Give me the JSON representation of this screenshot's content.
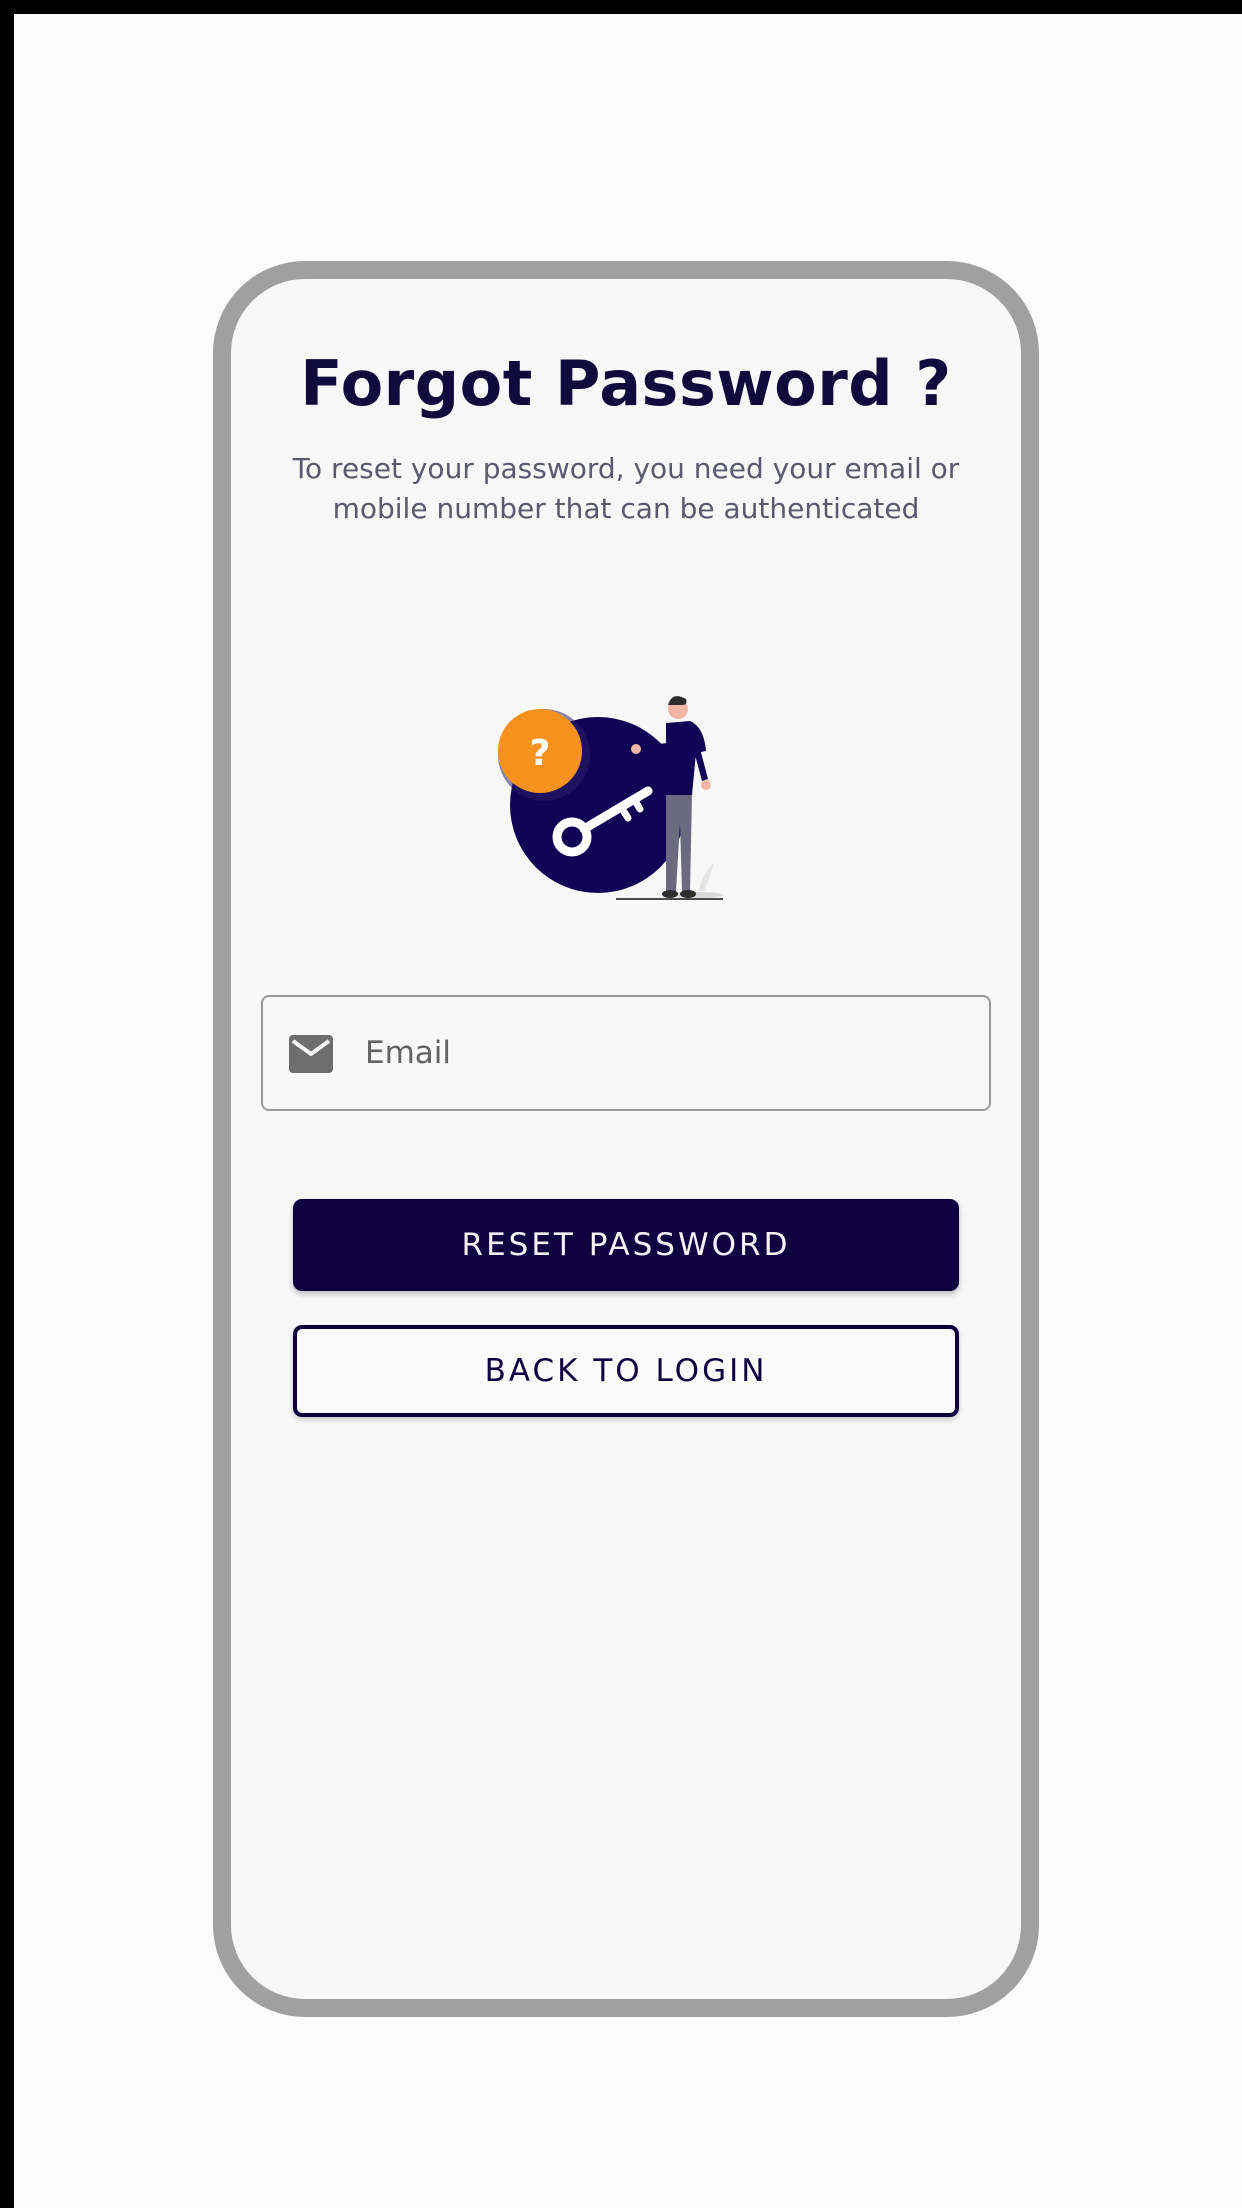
{
  "screen": {
    "title": "Forgot Password ?",
    "subtitle": "To reset your password, you need your email or mobile number that can be authenticated"
  },
  "illustration": {
    "badge_text": "?",
    "icons": [
      "key-icon",
      "question-badge-icon"
    ]
  },
  "email_field": {
    "icon": "mail-icon",
    "value": "",
    "placeholder": "Email"
  },
  "buttons": {
    "reset_label": "RESET PASSWORD",
    "back_label": "BACK TO LOGIN"
  },
  "colors": {
    "primary": "#0f0140",
    "accent": "#f7921e",
    "title": "#100a3d",
    "frame": "#a0a0a0"
  }
}
